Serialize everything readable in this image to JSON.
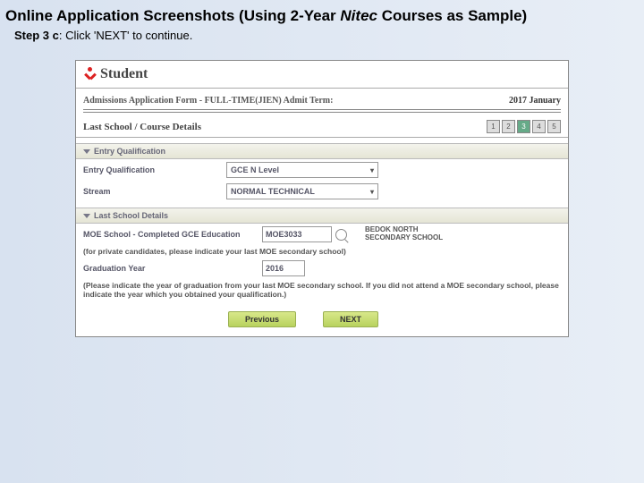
{
  "slide": {
    "title_pre": "Online Application Screenshots (Using 2-Year ",
    "title_italic": "Nitec",
    "title_post": " Courses as Sample)",
    "step_label": "Step 3 c",
    "step_text": ": Click 'NEXT' to continue."
  },
  "logo": {
    "text": "Student"
  },
  "form": {
    "header_title": "Admissions Application Form - FULL-TIME(JIEN)   Admit Term:",
    "admit_term": "2017 January",
    "section_title": "Last School / Course Details",
    "steps": [
      "1",
      "2",
      "3",
      "4",
      "5"
    ],
    "active_step_index": 2
  },
  "entry_qual": {
    "band": "Entry Qualification",
    "qual_label": "Entry Qualification",
    "qual_value": "GCE N Level",
    "stream_label": "Stream",
    "stream_value": "NORMAL TECHNICAL"
  },
  "last_school": {
    "band": "Last School Details",
    "moe_label": "MOE School - Completed GCE Education",
    "moe_value": "MOE3033",
    "school_name": "BEDOK NORTH SECONDARY SCHOOL",
    "note1": "(for private candidates, please indicate your last MOE secondary school)",
    "grad_label": "Graduation Year",
    "grad_value": "2016",
    "note2": "(Please indicate the year of graduation from your last MOE secondary school. If you did not attend a MOE secondary school, please indicate the year which you obtained your qualification.)"
  },
  "buttons": {
    "prev": "Previous",
    "next": "NEXT"
  }
}
